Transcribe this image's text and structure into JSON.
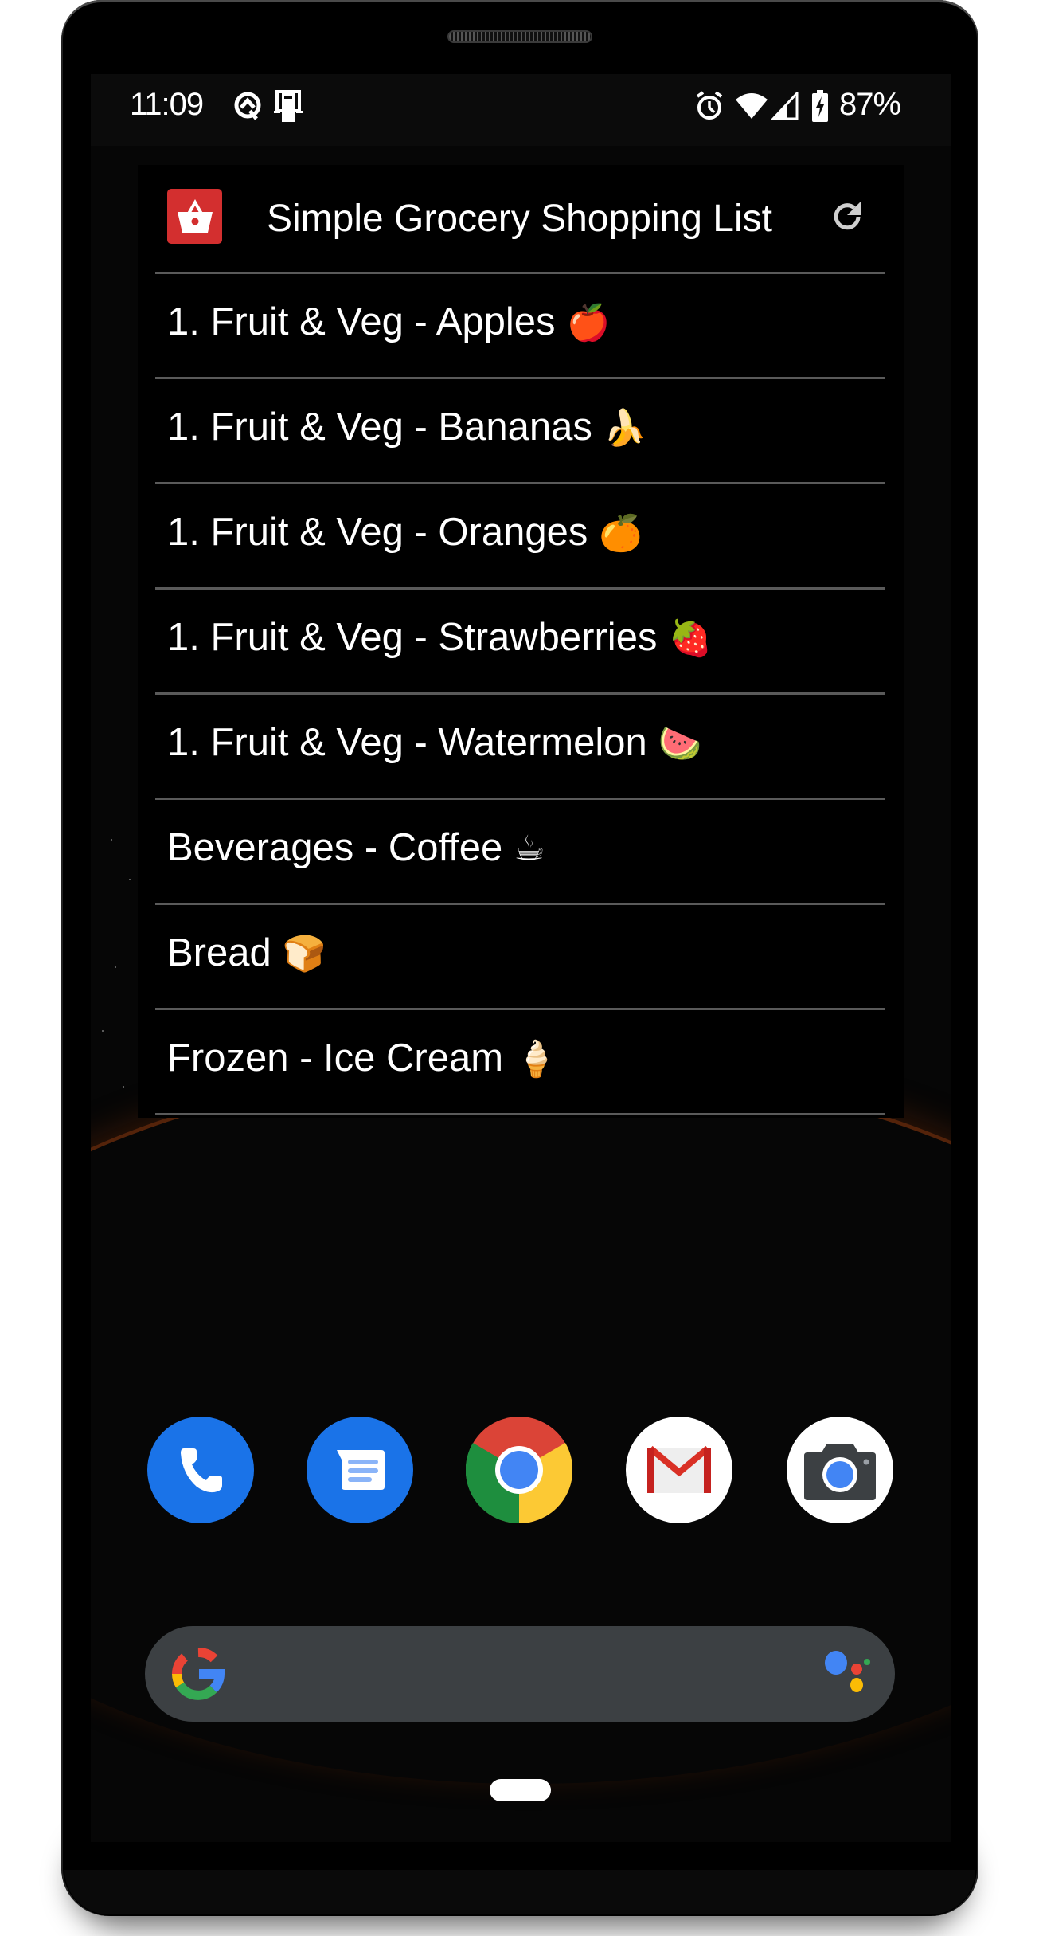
{
  "status_bar": {
    "time": "11:09",
    "left_icons": [
      "android-q-icon",
      "device-mirror-icon"
    ],
    "right_icons": [
      "alarm-icon",
      "wifi-icon",
      "cell-signal-icon",
      "battery-charging-icon"
    ],
    "battery_percent": "87%"
  },
  "widget": {
    "title": "Simple Grocery Shopping List",
    "app_icon": "shopping-basket-icon",
    "app_icon_color": "#d32f2f",
    "refresh_icon": "refresh-icon",
    "items": [
      {
        "label": "1. Fruit & Veg - Apples",
        "emoji": "🍎"
      },
      {
        "label": "1. Fruit & Veg - Bananas",
        "emoji": "🍌"
      },
      {
        "label": "1. Fruit & Veg - Oranges",
        "emoji": "🍊"
      },
      {
        "label": "1. Fruit & Veg - Strawberries",
        "emoji": "🍓"
      },
      {
        "label": "1. Fruit & Veg - Watermelon",
        "emoji": "🍉"
      },
      {
        "label": "Beverages - Coffee",
        "emoji": "☕"
      },
      {
        "label": "Bread",
        "emoji": "🍞"
      },
      {
        "label": "Frozen - Ice Cream",
        "emoji": "🍦"
      }
    ]
  },
  "dock": {
    "apps": [
      {
        "name": "Phone",
        "icon": "phone-icon",
        "color": "#1a73e8"
      },
      {
        "name": "Messages",
        "icon": "messages-icon",
        "color": "#1a73e8"
      },
      {
        "name": "Chrome",
        "icon": "chrome-icon",
        "color": "#4285f4"
      },
      {
        "name": "Gmail",
        "icon": "gmail-icon",
        "color": "#ffffff"
      },
      {
        "name": "Camera",
        "icon": "camera-icon",
        "color": "#ffffff"
      }
    ]
  },
  "search_bar": {
    "logo": "google-g-icon",
    "assistant": "google-assistant-icon",
    "placeholder": ""
  },
  "nav": {
    "home": "home-pill"
  },
  "colors": {
    "google_blue": "#4285f4",
    "google_red": "#ea4335",
    "google_yellow": "#fbbc05",
    "google_green": "#34a853",
    "searchbar_bg": "#3c4043",
    "divider": "#5a5a5a"
  }
}
